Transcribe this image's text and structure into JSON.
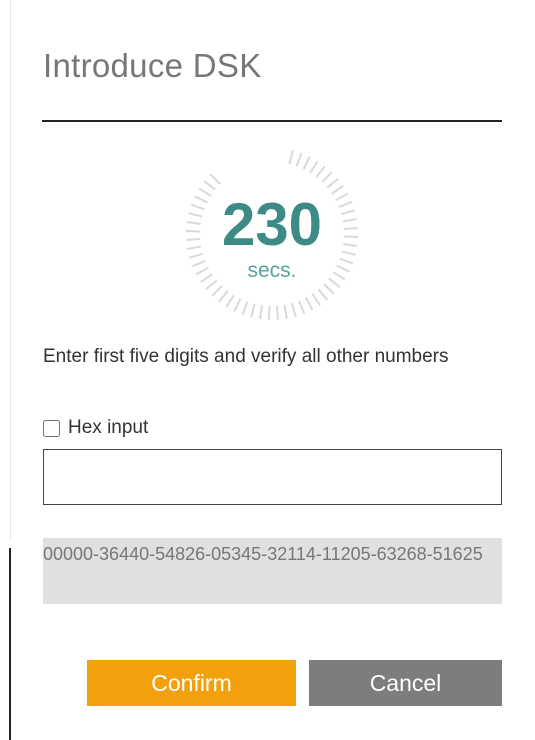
{
  "dialog": {
    "title": "Introduce DSK"
  },
  "timer": {
    "value": "230",
    "unit": "secs.",
    "total_ticks": 60,
    "active_ticks": 51,
    "tick_color": "#d9d9d9",
    "value_color": "#3d8b84"
  },
  "form": {
    "instructions": "Enter first five digits and verify all other numbers",
    "hex_label": "Hex input",
    "hex_checked": false,
    "dsk_input_value": "",
    "dsk_readout": "00000-36440-54826-05345-32114-11205-63268-51625"
  },
  "actions": {
    "confirm_label": "Confirm",
    "cancel_label": "Cancel",
    "confirm_color": "#f2a10d",
    "cancel_color": "#7d7d7d"
  }
}
